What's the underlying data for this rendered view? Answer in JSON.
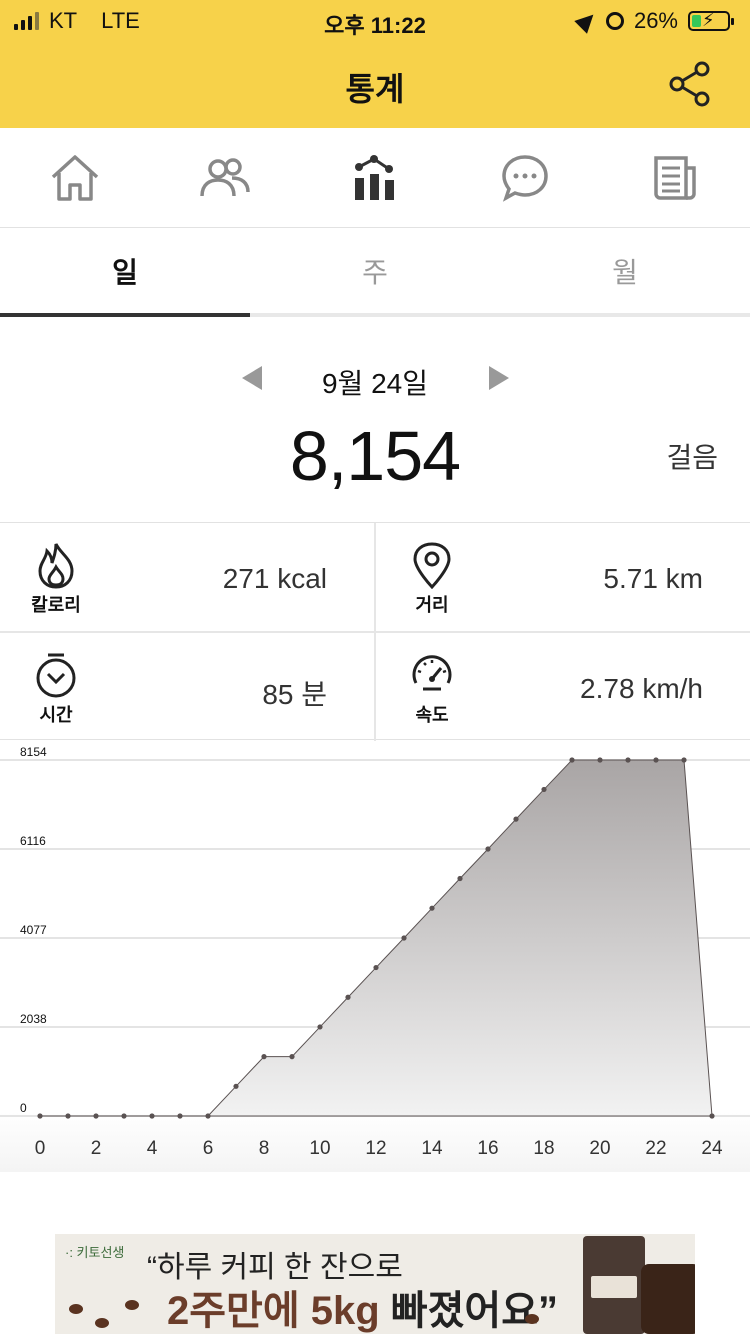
{
  "status": {
    "carrier": "KT",
    "network": "LTE",
    "time": "오후 11:22",
    "battery": "26%",
    "battery_level": 0.26
  },
  "header": {
    "title": "통계"
  },
  "nav": {
    "items": [
      "home-icon",
      "people-icon",
      "stats-icon",
      "chat-icon",
      "news-icon"
    ],
    "active": "stats-icon"
  },
  "tabs": {
    "items": [
      {
        "label": "일",
        "active": true
      },
      {
        "label": "주",
        "active": false
      },
      {
        "label": "월",
        "active": false
      }
    ]
  },
  "summary": {
    "date": "9월 24일",
    "steps": "8,154",
    "steps_unit": "걸음"
  },
  "stats": {
    "calories": {
      "label": "칼로리",
      "value": "271 kcal"
    },
    "distance": {
      "label": "거리",
      "value": "5.71 km"
    },
    "time": {
      "label": "시간",
      "value": "85 분"
    },
    "speed": {
      "label": "속도",
      "value": "2.78 km/h"
    }
  },
  "chart_data": {
    "type": "area",
    "x": [
      0,
      1,
      2,
      3,
      4,
      5,
      6,
      7,
      8,
      9,
      10,
      11,
      12,
      13,
      14,
      15,
      16,
      17,
      18,
      19,
      20,
      21,
      22,
      23,
      24
    ],
    "values": [
      0,
      0,
      0,
      0,
      0,
      0,
      0,
      680,
      1360,
      1360,
      2040,
      2720,
      3400,
      4077,
      4760,
      5440,
      6116,
      6800,
      7480,
      8154,
      8154,
      8154,
      8154,
      8154,
      0
    ],
    "x_ticks": [
      "0",
      "2",
      "4",
      "6",
      "8",
      "10",
      "12",
      "14",
      "16",
      "18",
      "20",
      "22",
      "24"
    ],
    "y_ticks": [
      "0",
      "2038",
      "4077",
      "6116",
      "8154"
    ],
    "ylim": [
      0,
      8154
    ],
    "xlim": [
      0,
      24
    ],
    "grid": true
  },
  "ad": {
    "brand": "·: 키토선생",
    "line1": "“하루 커피 한 잔으로",
    "line2_a": "2주만에 5kg",
    "line2_b": " 빠졌어요”"
  },
  "colors": {
    "header_bg": "#f7d24a",
    "area_fill_top": "#a9a5a5",
    "area_fill_bottom": "#f2f2f2",
    "point": "#5a5252"
  }
}
